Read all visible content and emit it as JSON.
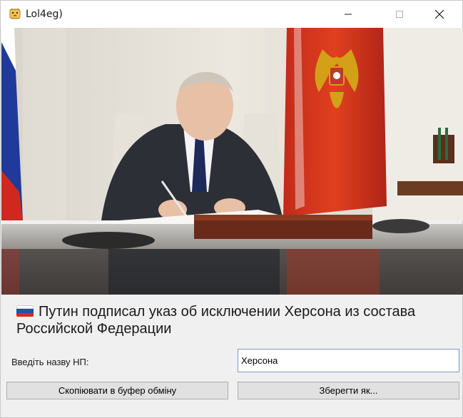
{
  "window": {
    "title": "Lol4eg)",
    "icon": "pixel-cat-icon",
    "controls": [
      "minimize-icon",
      "maximize-icon",
      "close-icon"
    ]
  },
  "photo": {
    "description_icon": "news-photo"
  },
  "headline": {
    "flag": "russia-flag-icon",
    "text": "Путин подписал указ об исключении Херсона из состава Российской Федерации"
  },
  "form": {
    "label": "Введіть назву НП:",
    "value": "Херсона"
  },
  "buttons": {
    "copy_label": "Скопіювати в буфер обміну",
    "save_label": "Зберегти як..."
  },
  "colors": {
    "input_border": "#7a9cc6",
    "button_bg": "#e1e1e1",
    "window_bg": "#f0f0f0"
  }
}
